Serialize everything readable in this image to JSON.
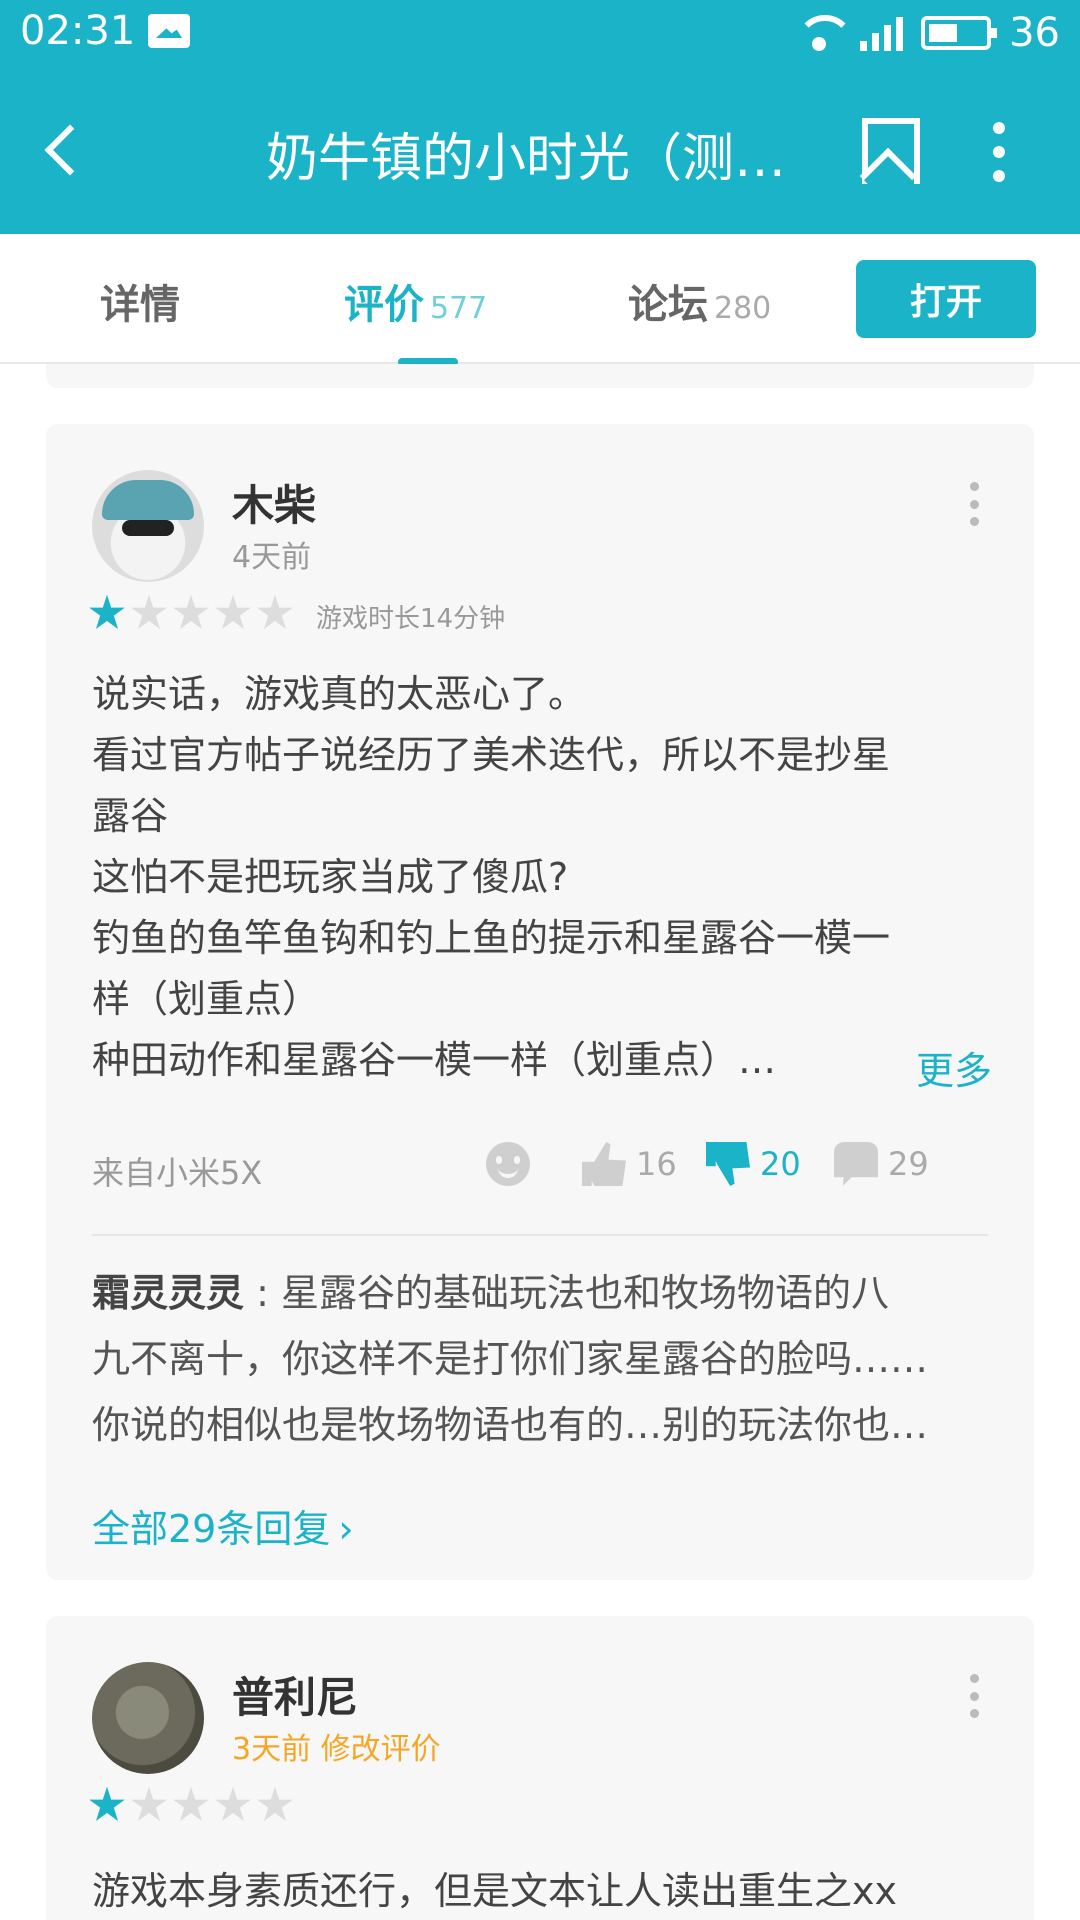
{
  "status_bar": {
    "time": "02:31",
    "battery": "36",
    "network": "4G"
  },
  "app_bar": {
    "title": "奶牛镇的小时光（测…"
  },
  "tabs": [
    {
      "label": "详情",
      "count": ""
    },
    {
      "label": "评价",
      "count": "577"
    },
    {
      "label": "论坛",
      "count": "280"
    }
  ],
  "open_button": "打开",
  "reviews": [
    {
      "username": "木柴",
      "time": "4天前",
      "rating": 1,
      "play_time": "游戏时长14分钟",
      "lines": [
        "说实话，游戏真的太恶心了。",
        "看过官方帖子说经历了美术迭代，所以不是抄星",
        "露谷",
        "这怕不是把玩家当成了傻瓜?",
        "钓鱼的鱼竿鱼钩和钓上鱼的提示和星露谷一模一",
        "样（划重点）",
        "种田动作和星露谷一模一样（划重点）…"
      ],
      "more": "更多",
      "device": "来自小米5X",
      "likes": "16",
      "dislikes": "20",
      "comments": "29",
      "reply": {
        "author": "霜灵灵灵",
        "separator": " : ",
        "line1": "星露谷的基础玩法也和牧场物语的八",
        "line2": "九不离十，你这样不是打你们家星露谷的脸吗……",
        "line3": "你说的相似也是牧场物语也有的…别的玩法你也…"
      },
      "all_replies": "全部29条回复"
    },
    {
      "username": "普利尼",
      "time": "3天前 修改评价",
      "rating": 1,
      "line": "游戏本身素质还行，但是文本让人读出重生之xx"
    }
  ],
  "colors": {
    "accent": "#1ab3c7",
    "orange": "#f5a623"
  }
}
